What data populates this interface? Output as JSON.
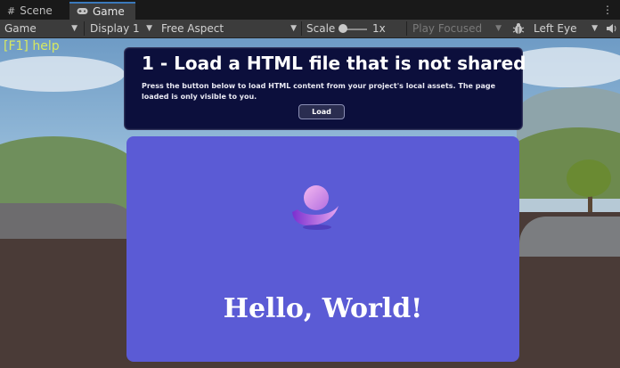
{
  "tabs": [
    {
      "label": "Scene",
      "icon": "grid-icon"
    },
    {
      "label": "Game",
      "icon": "gamepad-icon"
    }
  ],
  "toolbar": {
    "game_mode": "Game",
    "display": "Display 1",
    "aspect": "Free Aspect",
    "scale_label": "Scale",
    "scale_value": "1x",
    "play_mode": "Play Focused",
    "eye": "Left Eye"
  },
  "overlay": {
    "help": "[F1] help"
  },
  "top_panel": {
    "title": "1 - Load a HTML file that is not shared",
    "description": "Press the button below to load HTML content from your project's local assets. The page loaded is only visible to you.",
    "button_label": "Load"
  },
  "main_panel": {
    "greeting": "Hello, World!"
  },
  "colors": {
    "top_panel_bg": "#0c0f3c",
    "main_panel_bg": "#5b5bd5",
    "help_text": "#d7e860",
    "active_tab_accent": "#3a79bb"
  }
}
